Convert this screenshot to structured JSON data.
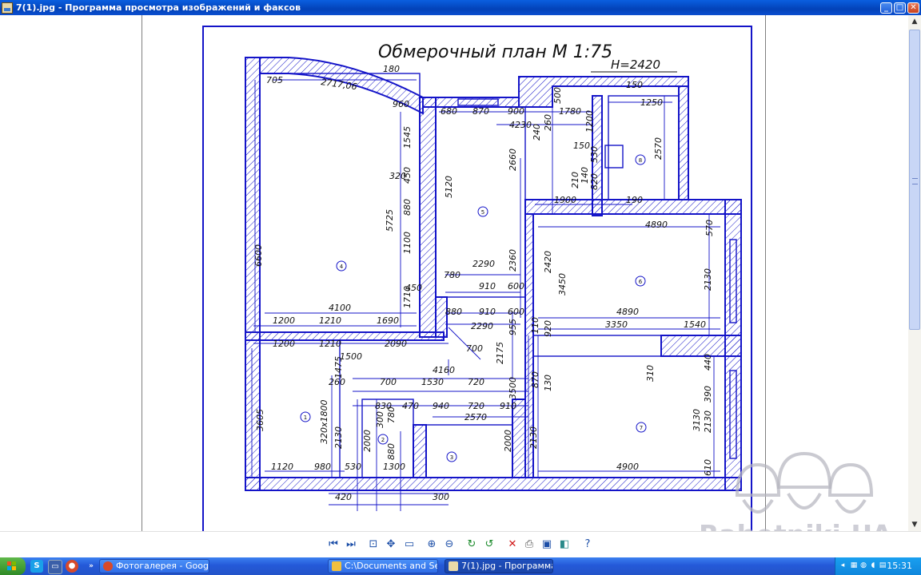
{
  "window": {
    "title": "7(1).jpg - Программа просмотра изображений и факсов",
    "minimize": "_",
    "maximize": "□",
    "close": "✕"
  },
  "plan": {
    "title": "Обмерочный план М 1:75",
    "height_label": "Н=2420",
    "room_numbers": [
      "1",
      "2",
      "3",
      "4",
      "5",
      "6",
      "7",
      "8"
    ],
    "dimensions": {
      "d705": "705",
      "d2717": "2717,06",
      "d180": "180",
      "d960": "960",
      "d680": "680",
      "d870": "870",
      "d900": "900",
      "d500": "500",
      "d1780": "1780",
      "d150a": "150",
      "d1250": "1250",
      "d4230": "4230",
      "d240": "240",
      "d260": "260",
      "d1200v": "1200",
      "d2570": "2570",
      "d150b": "150",
      "d530": "530",
      "d1545": "1545",
      "d2660": "2660",
      "d320": "320",
      "d450a": "450",
      "d5120": "5120",
      "d210": "210",
      "d140": "140",
      "d820": "820",
      "d880a": "880",
      "d1900": "1900",
      "d190": "190",
      "d5725": "5725",
      "d4890a": "4890",
      "d570": "570",
      "d6600": "6600",
      "d1100": "1100",
      "d2290a": "2290",
      "d2360": "2360",
      "d2420": "2420",
      "d3450": "3450",
      "d2130a": "2130",
      "d780": "780",
      "d910a": "910",
      "d600a": "600",
      "d450b": "450",
      "d1710": "1710",
      "d4100": "4100",
      "d880b": "880",
      "d910b": "910",
      "d600b": "600",
      "d4890b": "4890",
      "d1200a": "1200",
      "d1210a": "1210",
      "d1690": "1690",
      "d2290b": "2290",
      "d110": "110",
      "d955": "955",
      "d3350": "3350",
      "d1540": "1540",
      "d920": "920",
      "d1200b": "1200",
      "d1210b": "1210",
      "d1500": "1500",
      "d2090": "2090",
      "d700a": "700",
      "d2175": "2175",
      "d1475": "1475",
      "d4160": "4160",
      "d310": "310",
      "d440": "440",
      "d260b": "260",
      "d700b": "700",
      "d1530": "1530",
      "d720a": "720",
      "d3500": "3500",
      "d870b": "870",
      "d130": "130",
      "d390": "390",
      "d830": "830",
      "d470": "470",
      "d940": "940",
      "d720b": "720",
      "d910c": "910",
      "d3605": "3605",
      "d320x1800": "320x1800",
      "d300": "300",
      "d780b": "780",
      "d2570b": "2570",
      "d2130b": "2130",
      "d3130": "3130",
      "d2130c": "2130",
      "d2000a": "2000",
      "d2000b": "2000",
      "d2130d": "2130",
      "d880c": "880",
      "d1120": "1120",
      "d980": "980",
      "d530b": "530",
      "d1300": "1300",
      "d4900": "4900",
      "d610": "610",
      "d420": "420",
      "d300b": "300"
    }
  },
  "watermark": "Rabotniki.UA",
  "toolbar": {
    "icons": [
      "prev-image-icon",
      "next-image-icon",
      "best-fit-icon",
      "actual-size-icon",
      "slideshow-icon",
      "zoom-in-icon",
      "zoom-out-icon",
      "rotate-cw-icon",
      "rotate-ccw-icon",
      "delete-icon",
      "print-icon",
      "save-icon",
      "open-with-icon",
      "help-icon"
    ]
  },
  "taskbar": {
    "tasks": [
      {
        "label": "Фотогалерея - Googl..."
      },
      {
        "label": "C:\\Documents and Se..."
      },
      {
        "label": "7(1).jpg - Программа..."
      }
    ],
    "clock": "15:31"
  },
  "colors": {
    "plan_blue": "#1414c8",
    "titlebar": "#0a5fe0",
    "taskbar": "#2459d8"
  }
}
